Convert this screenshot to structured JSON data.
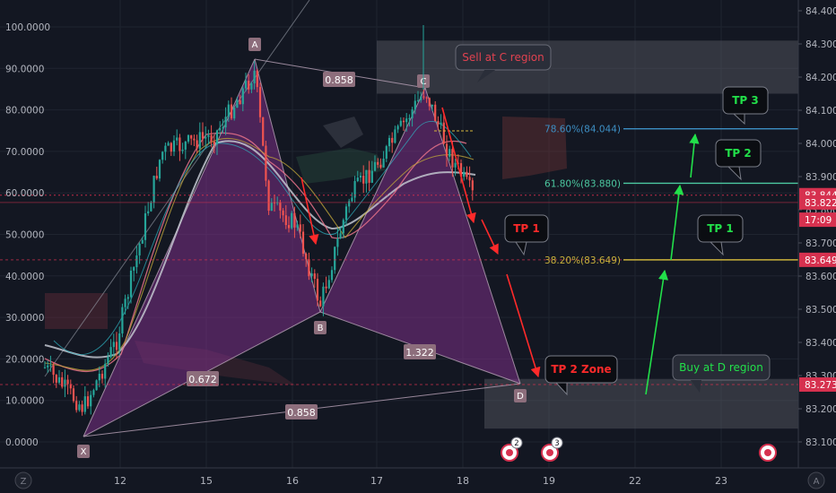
{
  "chart_data": {
    "type": "candlestick",
    "left_axis": {
      "ticks": [
        "100.0000",
        "90.0000",
        "80.0000",
        "70.0000",
        "60.0000",
        "50.0000",
        "40.0000",
        "30.0000",
        "20.0000",
        "10.0000",
        "0.0000"
      ],
      "range": [
        0,
        100
      ]
    },
    "right_axis": {
      "ticks": [
        "84.400",
        "84.300",
        "84.200",
        "84.100",
        "84.000",
        "83.900",
        "83.800",
        "83.700",
        "83.600",
        "83.500",
        "83.400",
        "83.300",
        "83.200",
        "83.100"
      ],
      "range": [
        83.06,
        84.43
      ]
    },
    "x_axis": {
      "ticks": [
        "12",
        "15",
        "16",
        "17",
        "18",
        "19",
        "22",
        "23"
      ]
    },
    "price_tags": [
      {
        "text": "83.844",
        "price": 83.844,
        "color": "#d6314f"
      },
      {
        "text": "83.822",
        "price": 83.822,
        "color": "#d6314f"
      },
      {
        "text": "17:09",
        "price": 83.77,
        "color": "#d6314f"
      },
      {
        "text": "83.649",
        "price": 83.649,
        "color": "#d6314f"
      },
      {
        "text": "83.273",
        "price": 83.273,
        "color": "#d6314f"
      }
    ],
    "pattern": {
      "points": {
        "X": "X",
        "A": "A",
        "B": "B",
        "C": "C",
        "D": "D"
      },
      "ratios": {
        "XB": "0.672",
        "AC": "0.858",
        "BD": "1.322",
        "XD": "0.858"
      }
    },
    "fib_levels": [
      {
        "label": "78.60%(84.044)",
        "price": 84.044,
        "color": "#3d8fc4"
      },
      {
        "label": "61.80%(83.880)",
        "price": 83.88,
        "color": "#4cc8a0"
      },
      {
        "label": "38.20%(83.649)",
        "price": 83.649,
        "color": "#c9b13b"
      }
    ],
    "zones": [
      {
        "label": "Sell at C region",
        "price_top": 84.31,
        "price_bottom": 84.15
      },
      {
        "label": "Buy at D region",
        "price_top": 83.29,
        "price_bottom": 83.14
      }
    ],
    "callouts": [
      "TP 1",
      "TP 2 Zone",
      "TP 3",
      "TP 2",
      "TP 1"
    ],
    "event_badges": [
      "2",
      "3"
    ],
    "colors": {
      "background": "#131722",
      "up": "#26a69a",
      "down": "#ef5350",
      "pattern_fill": "#7b2f86",
      "text": "#b2b5be"
    }
  },
  "toolbar": {
    "left_icon_label": "Z",
    "right_icon_label": "A"
  }
}
